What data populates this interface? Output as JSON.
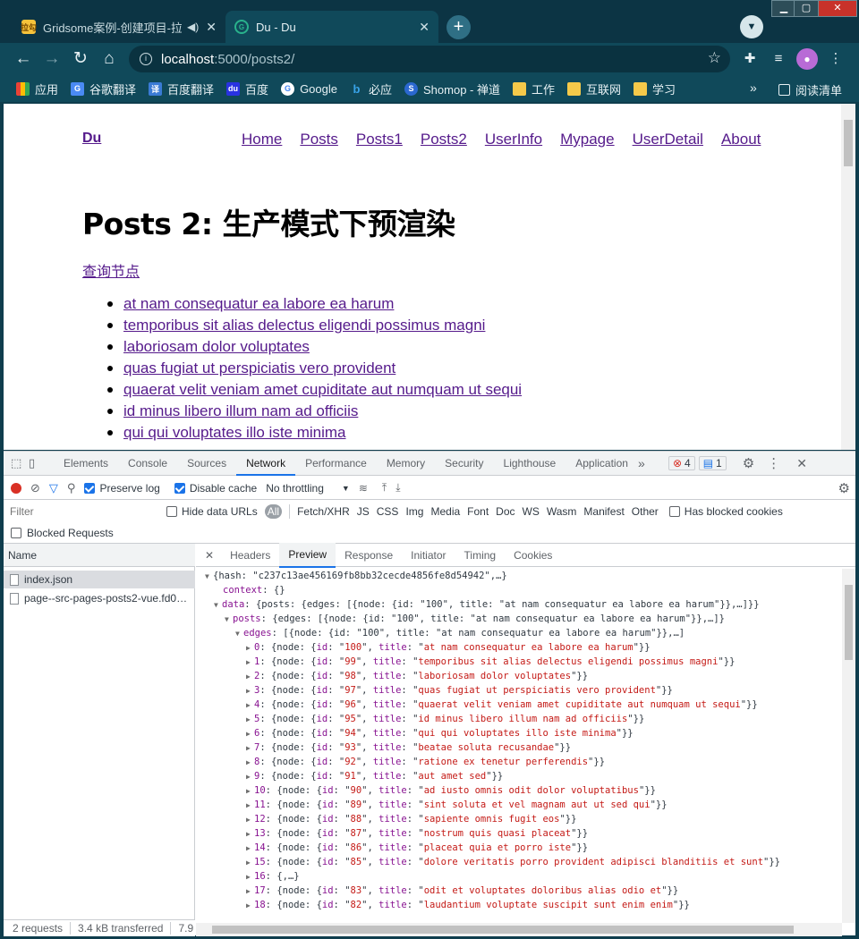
{
  "browser": {
    "tabs": [
      {
        "title": "Gridsome案例-创建项目-拉",
        "favicon": "拉勾",
        "has_audio": true
      },
      {
        "title": "Du - Du",
        "favicon": "G",
        "active": true
      }
    ],
    "url_host": "localhost",
    "url_path": ":5000/posts2/",
    "bookmarks": [
      {
        "label": "应用",
        "icon": "apps-icon"
      },
      {
        "label": "谷歌翻译",
        "icon": "translate-icon"
      },
      {
        "label": "百度翻译",
        "icon": "baidu-translate-icon"
      },
      {
        "label": "百度",
        "icon": "baidu-icon"
      },
      {
        "label": "Google",
        "icon": "google-icon"
      },
      {
        "label": "必应",
        "icon": "bing-icon"
      },
      {
        "label": "Shomop - 禅道",
        "icon": "zentao-icon"
      },
      {
        "label": "工作",
        "icon": "folder-icon"
      },
      {
        "label": "互联网",
        "icon": "folder-icon"
      },
      {
        "label": "学习",
        "icon": "folder-icon"
      }
    ],
    "reading_list": "阅读清单"
  },
  "site": {
    "logo": "Du",
    "nav": [
      "Home",
      "Posts",
      "Posts1",
      "Posts2",
      "UserInfo",
      "Mypage",
      "UserDetail",
      "About"
    ],
    "heading": "Posts 2: 生产模式下预渲染",
    "query_link": "查询节点",
    "posts": [
      "at nam consequatur ea labore ea harum",
      "temporibus sit alias delectus eligendi possimus magni",
      "laboriosam dolor voluptates",
      "quas fugiat ut perspiciatis vero provident",
      "quaerat velit veniam amet cupiditate aut numquam ut sequi",
      "id minus libero illum nam ad officiis",
      "qui qui voluptates illo iste minima"
    ]
  },
  "devtools": {
    "tabs": [
      "Elements",
      "Console",
      "Sources",
      "Network",
      "Performance",
      "Memory",
      "Security",
      "Lighthouse",
      "Application"
    ],
    "selected_tab": "Network",
    "error_count": "4",
    "message_count": "1",
    "preserve_log": "Preserve log",
    "disable_cache": "Disable cache",
    "throttling": "No throttling",
    "filter_placeholder": "Filter",
    "hide_data_urls": "Hide data URLs",
    "filter_types": [
      "All",
      "Fetch/XHR",
      "JS",
      "CSS",
      "Img",
      "Media",
      "Font",
      "Doc",
      "WS",
      "Wasm",
      "Manifest",
      "Other"
    ],
    "has_blocked_cookies": "Has blocked cookies",
    "blocked_requests": "Blocked Requests",
    "name_header": "Name",
    "requests": [
      "index.json",
      "page--src-pages-posts2-vue.fd0…"
    ],
    "detail_tabs": [
      "Headers",
      "Preview",
      "Response",
      "Initiator",
      "Timing",
      "Cookies"
    ],
    "selected_detail_tab": "Preview",
    "status": {
      "requests": "2 requests",
      "transferred": "3.4 kB transferred",
      "extra": "7.9"
    },
    "preview": {
      "root": "{hash: \"c237c13ae456169fb8bb32cecde4856fe8d54942\",…}",
      "context": "{}",
      "data": "{posts: {edges: [{node: {id: \"100\", title: \"at nam consequatur ea labore ea harum\"}},…]}}",
      "posts": "{edges: [{node: {id: \"100\", title: \"at nam consequatur ea labore ea harum\"}},…]}",
      "edges": "[{node: {id: \"100\", title: \"at nam consequatur ea labore ea harum\"}},…]",
      "items": [
        {
          "i": "0",
          "id": "100",
          "title": "at nam consequatur ea labore ea harum"
        },
        {
          "i": "1",
          "id": "99",
          "title": "temporibus sit alias delectus eligendi possimus magni"
        },
        {
          "i": "2",
          "id": "98",
          "title": "laboriosam dolor voluptates"
        },
        {
          "i": "3",
          "id": "97",
          "title": "quas fugiat ut perspiciatis vero provident"
        },
        {
          "i": "4",
          "id": "96",
          "title": "quaerat velit veniam amet cupiditate aut numquam ut sequi"
        },
        {
          "i": "5",
          "id": "95",
          "title": "id minus libero illum nam ad officiis"
        },
        {
          "i": "6",
          "id": "94",
          "title": "qui qui voluptates illo iste minima"
        },
        {
          "i": "7",
          "id": "93",
          "title": "beatae soluta recusandae"
        },
        {
          "i": "8",
          "id": "92",
          "title": "ratione ex tenetur perferendis"
        },
        {
          "i": "9",
          "id": "91",
          "title": "aut amet sed"
        },
        {
          "i": "10",
          "id": "90",
          "title": "ad iusto omnis odit dolor voluptatibus"
        },
        {
          "i": "11",
          "id": "89",
          "title": "sint soluta et vel magnam aut ut sed qui"
        },
        {
          "i": "12",
          "id": "88",
          "title": "sapiente omnis fugit eos"
        },
        {
          "i": "13",
          "id": "87",
          "title": "nostrum quis quasi placeat"
        },
        {
          "i": "14",
          "id": "86",
          "title": "placeat quia et porro iste"
        },
        {
          "i": "15",
          "id": "85",
          "title": "dolore veritatis porro provident adipisci blanditiis et sunt"
        },
        {
          "i": "16",
          "collapsed": "{,…}"
        },
        {
          "i": "17",
          "id": "83",
          "title": "odit et voluptates doloribus alias odio et"
        },
        {
          "i": "18",
          "id": "82",
          "title": "laudantium voluptate suscipit sunt enim enim"
        }
      ]
    }
  }
}
